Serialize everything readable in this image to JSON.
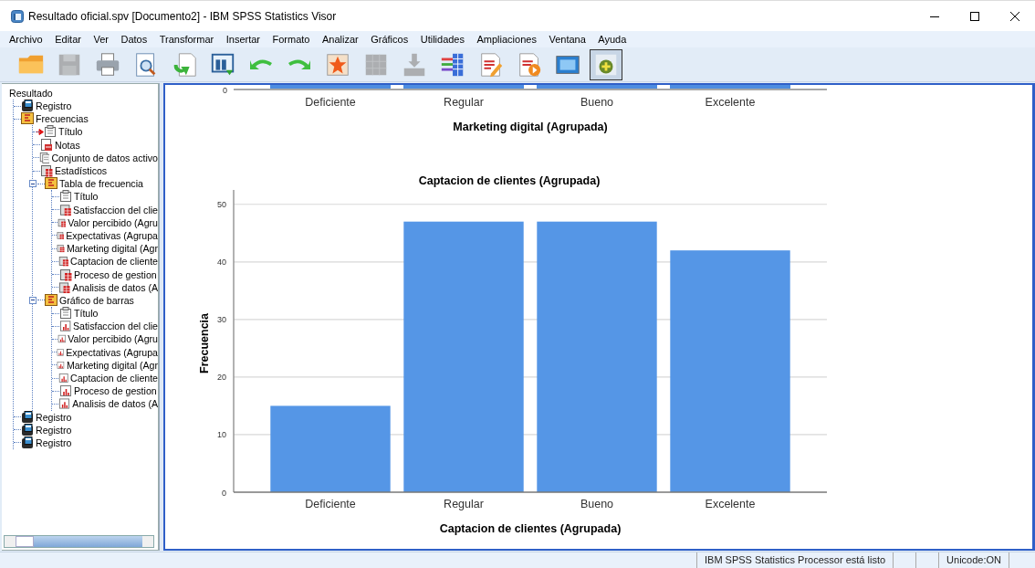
{
  "window": {
    "title": "Resultado oficial.spv [Documento2] - IBM SPSS Statistics Visor"
  },
  "menu": [
    "Archivo",
    "Editar",
    "Ver",
    "Datos",
    "Transformar",
    "Insertar",
    "Formato",
    "Analizar",
    "Gráficos",
    "Utilidades",
    "Ampliaciones",
    "Ventana",
    "Ayuda"
  ],
  "toolbar": [
    {
      "kind": "open",
      "disabled": false,
      "pressed": false
    },
    {
      "kind": "save",
      "disabled": true,
      "pressed": false
    },
    {
      "kind": "print",
      "disabled": false,
      "pressed": false
    },
    {
      "kind": "preview",
      "disabled": false,
      "pressed": false
    },
    {
      "kind": "export",
      "disabled": false,
      "pressed": false
    },
    {
      "kind": "recall",
      "disabled": false,
      "pressed": false
    },
    {
      "kind": "undo",
      "disabled": false,
      "pressed": false
    },
    {
      "kind": "redo",
      "disabled": false,
      "pressed": false
    },
    {
      "kind": "goto",
      "disabled": false,
      "pressed": false
    },
    {
      "kind": "grid",
      "disabled": true,
      "pressed": false
    },
    {
      "kind": "insert",
      "disabled": true,
      "pressed": false
    },
    {
      "kind": "variables",
      "disabled": false,
      "pressed": false
    },
    {
      "kind": "edit",
      "disabled": false,
      "pressed": false
    },
    {
      "kind": "run",
      "disabled": false,
      "pressed": false
    },
    {
      "kind": "screen",
      "disabled": false,
      "pressed": false
    },
    {
      "kind": "add",
      "disabled": false,
      "pressed": true
    }
  ],
  "outline": {
    "root": "Resultado",
    "children": [
      {
        "label": "Registro",
        "kind": "log"
      },
      {
        "label": "Frecuencias",
        "kind": "output",
        "children": [
          {
            "label": "Título",
            "kind": "title",
            "current": true
          },
          {
            "label": "Notas",
            "kind": "notes",
            "current": false
          },
          {
            "label": "Conjunto de datos activo",
            "kind": "dataset",
            "current": false
          },
          {
            "label": "Estadísticos",
            "kind": "table",
            "current": false
          },
          {
            "label": "Tabla de frecuencia",
            "kind": "output",
            "expanded": true,
            "current": false,
            "children": [
              {
                "label": "Título",
                "kind": "title"
              },
              {
                "label": "Satisfaccion del clie",
                "kind": "table"
              },
              {
                "label": "Valor percibido (Agru",
                "kind": "table"
              },
              {
                "label": "Expectativas (Agrupa",
                "kind": "table"
              },
              {
                "label": "Marketing digital (Agr",
                "kind": "table"
              },
              {
                "label": "Captacion de cliente",
                "kind": "table"
              },
              {
                "label": "Proceso de gestion",
                "kind": "table"
              },
              {
                "label": "Analisis de datos (A",
                "kind": "table"
              }
            ]
          },
          {
            "label": "Gráfico de barras",
            "kind": "output",
            "expanded": true,
            "current": false,
            "children": [
              {
                "label": "Título",
                "kind": "title"
              },
              {
                "label": "Satisfaccion del clie",
                "kind": "chart"
              },
              {
                "label": "Valor percibido (Agru",
                "kind": "chart"
              },
              {
                "label": "Expectativas (Agrupa",
                "kind": "chart"
              },
              {
                "label": "Marketing digital (Agr",
                "kind": "chart"
              },
              {
                "label": "Captacion de cliente",
                "kind": "chart"
              },
              {
                "label": "Proceso de gestion",
                "kind": "chart"
              },
              {
                "label": "Analisis de datos (A",
                "kind": "chart"
              }
            ]
          }
        ]
      },
      {
        "label": "Registro",
        "kind": "log"
      },
      {
        "label": "Registro",
        "kind": "log"
      },
      {
        "label": "Registro",
        "kind": "log"
      }
    ]
  },
  "previous_chart": {
    "ytick": "0",
    "categories": [
      "Deficiente",
      "Regular",
      "Bueno",
      "Excelente"
    ],
    "xlabel": "Marketing digital (Agrupada)"
  },
  "chart": {
    "chart_data": {
      "type": "bar",
      "title": "Captacion de clientes (Agrupada)",
      "xlabel": "Captacion de clientes (Agrupada)",
      "ylabel": "Frecuencia",
      "categories": [
        "Deficiente",
        "Regular",
        "Bueno",
        "Excelente"
      ],
      "series": [
        {
          "color": "#5596e6",
          "values": [
            15,
            47,
            47,
            42
          ]
        }
      ],
      "ylim": [
        0,
        52.5
      ],
      "yticks": [
        0,
        10,
        20,
        30,
        40,
        50
      ],
      "grid": true
    }
  },
  "status_bar": [
    "IBM SPSS Statistics Processor está listo",
    "Unicode:ON"
  ]
}
